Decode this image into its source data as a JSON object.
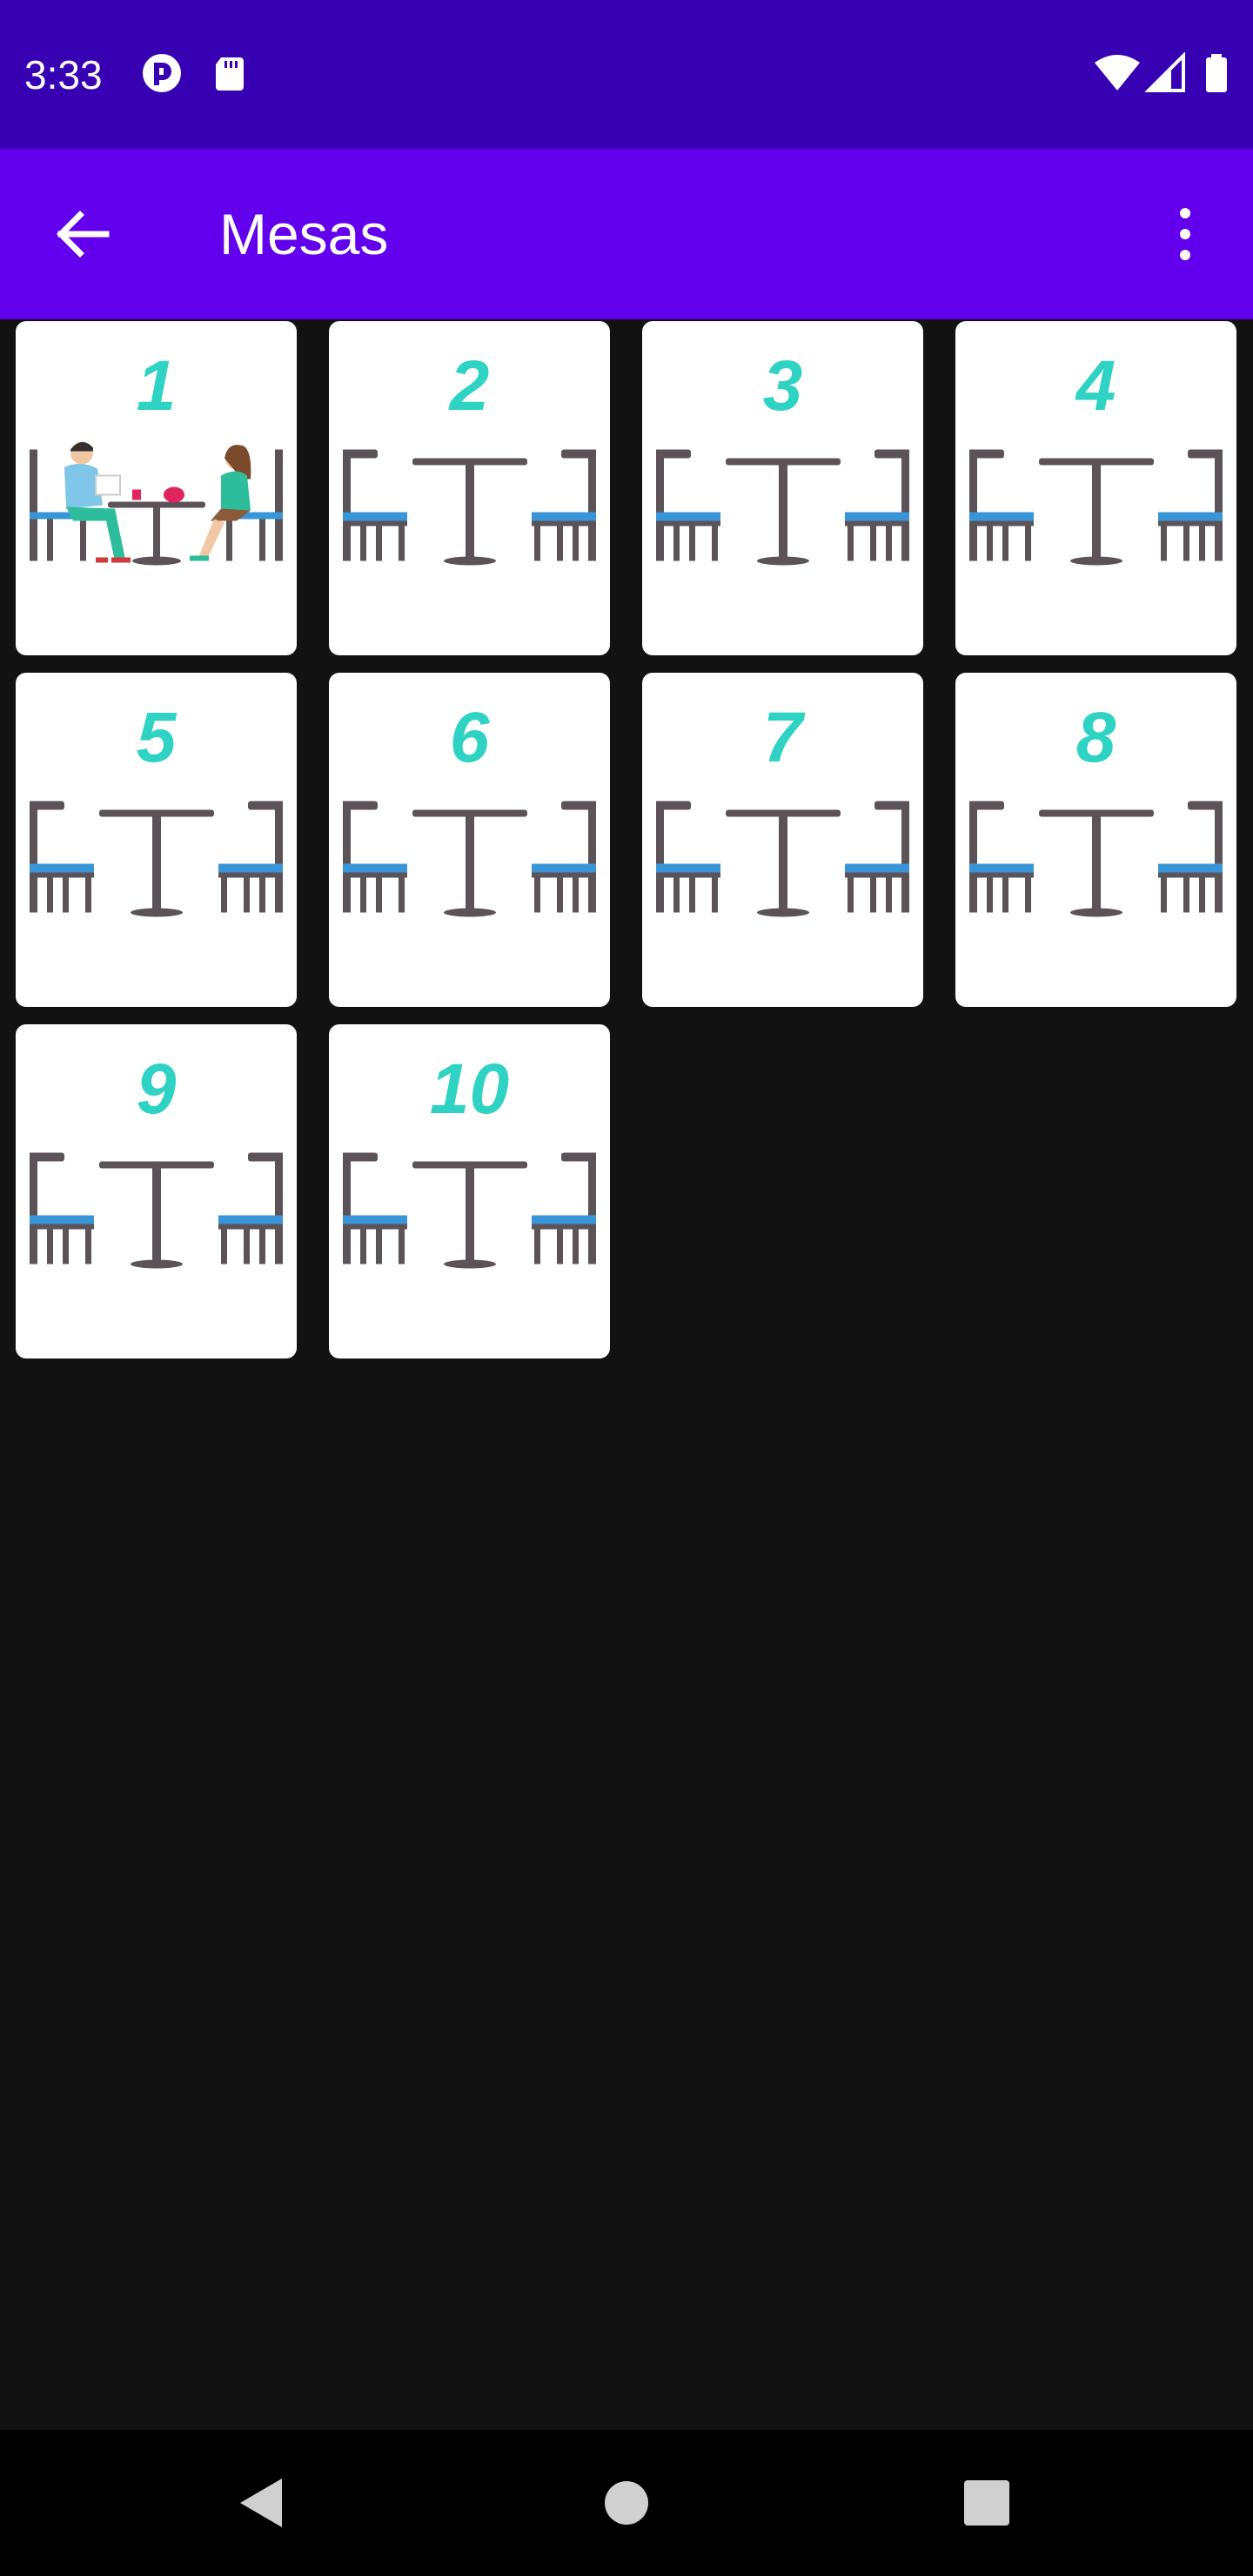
{
  "status_bar": {
    "time": "3:33",
    "left_icons": [
      "notification-app-icon",
      "sd-card-icon"
    ],
    "right_icons": [
      "wifi-icon",
      "signal-icon",
      "battery-icon"
    ],
    "background": "#3700B3"
  },
  "app_bar": {
    "title": "Mesas",
    "background": "#6200EE",
    "back_icon": "arrow-back-icon",
    "menu_icon": "more-vert-icon"
  },
  "tables": [
    {
      "number": "1",
      "image": "couple-at-table"
    },
    {
      "number": "2",
      "image": "empty-table"
    },
    {
      "number": "3",
      "image": "empty-table"
    },
    {
      "number": "4",
      "image": "empty-table"
    },
    {
      "number": "5",
      "image": "empty-table"
    },
    {
      "number": "6",
      "image": "empty-table"
    },
    {
      "number": "7",
      "image": "empty-table"
    },
    {
      "number": "8",
      "image": "empty-table"
    },
    {
      "number": "9",
      "image": "empty-table"
    },
    {
      "number": "10",
      "image": "empty-table"
    }
  ],
  "colors": {
    "number_color": "#2ED3C4",
    "page_background": "#121212",
    "card_background": "#FFFFFF"
  },
  "nav_bar": {
    "buttons": [
      "back-triangle-icon",
      "home-circle-icon",
      "recents-square-icon"
    ]
  }
}
